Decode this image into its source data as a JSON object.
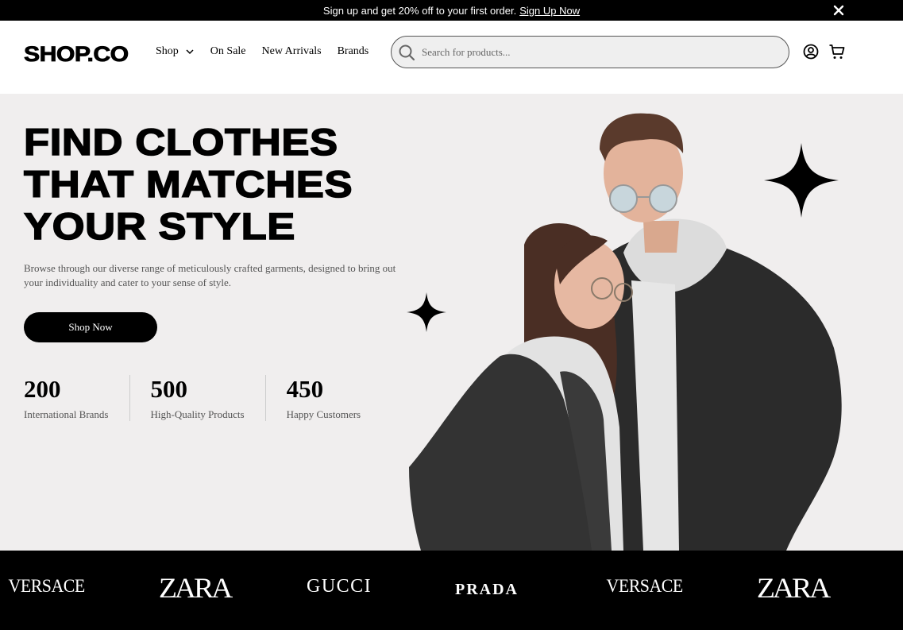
{
  "topbar": {
    "promo_text": "Sign up and get 20% off to your first order.",
    "promo_link": "Sign Up Now"
  },
  "header": {
    "logo": "SHOP.CO",
    "nav": [
      {
        "label": "Shop",
        "has_dropdown": true
      },
      {
        "label": "On Sale"
      },
      {
        "label": "New Arrivals"
      },
      {
        "label": "Brands"
      }
    ],
    "search_placeholder": "Search for products...",
    "icons": [
      "user-icon",
      "cart-icon"
    ]
  },
  "hero": {
    "title_lines": [
      "FIND CLOTHES",
      "THAT MATCHES",
      "YOUR STYLE"
    ],
    "description": "Browse through our diverse range of meticulously crafted garments, designed to bring out your individuality and cater to your sense of style.",
    "cta_label": "Shop Now",
    "stats": [
      {
        "value": "200",
        "label": "International Brands"
      },
      {
        "value": "500",
        "label": "High-Quality Products"
      },
      {
        "value": "450",
        "label": "Happy Customers"
      }
    ]
  },
  "brands": [
    "VERSACE",
    "ZARA",
    "GUCCI",
    "PRADA",
    "VERSACE",
    "ZARA"
  ],
  "colors": {
    "topbar_bg": "#000000",
    "hero_bg": "#f0eeee",
    "brand_strip_bg": "#000000",
    "accent": "#000000"
  }
}
